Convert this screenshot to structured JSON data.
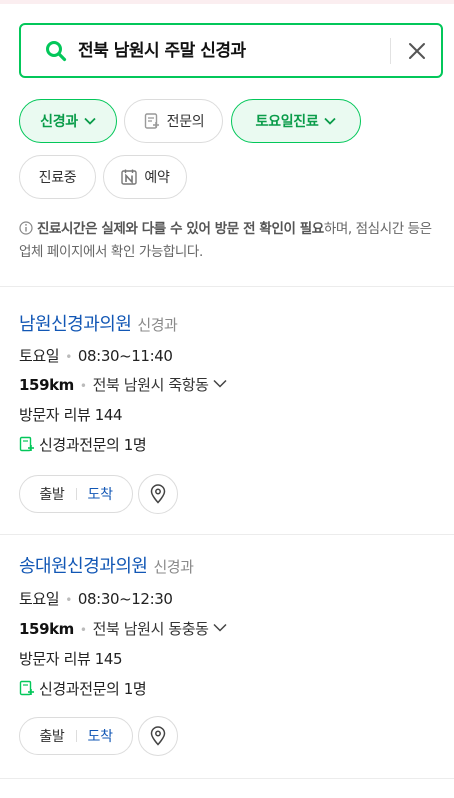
{
  "search": {
    "query": "전북 남원시 주말 신경과",
    "icon": "search-icon",
    "clear_icon": "close-icon"
  },
  "filters": [
    {
      "label": "신경과",
      "active": true,
      "has_dropdown": true
    },
    {
      "label": "전문의",
      "active": false,
      "icon": "specialist-doc-icon"
    },
    {
      "label": "토요일진료",
      "active": true,
      "has_dropdown": true
    },
    {
      "label": "진료중",
      "active": false
    },
    {
      "label": "예약",
      "active": false,
      "icon": "naver-booking-icon"
    }
  ],
  "notice": {
    "bold": "진료시간은 실제와 다를 수 있어 방문 전 확인이 필요",
    "text": "하며, 점심시간 등은 업체 페이지에서 확인 가능합니다."
  },
  "results": [
    {
      "name": "남원신경과의원",
      "category": "신경과",
      "day": "토요일",
      "hours": "08:30~11:40",
      "distance": "159km",
      "address": "전북 남원시 죽항동",
      "reviews": "방문자 리뷰 144",
      "specialists": "신경과전문의 1명",
      "depart_label": "출발",
      "arrive_label": "도착"
    },
    {
      "name": "송대원신경과의원",
      "category": "신경과",
      "day": "토요일",
      "hours": "08:30~12:30",
      "distance": "159km",
      "address": "전북 남원시 동충동",
      "reviews": "방문자 리뷰 145",
      "specialists": "신경과전문의 1명",
      "depart_label": "출발",
      "arrive_label": "도착"
    }
  ],
  "colors": {
    "accent": "#03c75a",
    "accent_text": "#0a9c4a",
    "link": "#1257b5"
  }
}
